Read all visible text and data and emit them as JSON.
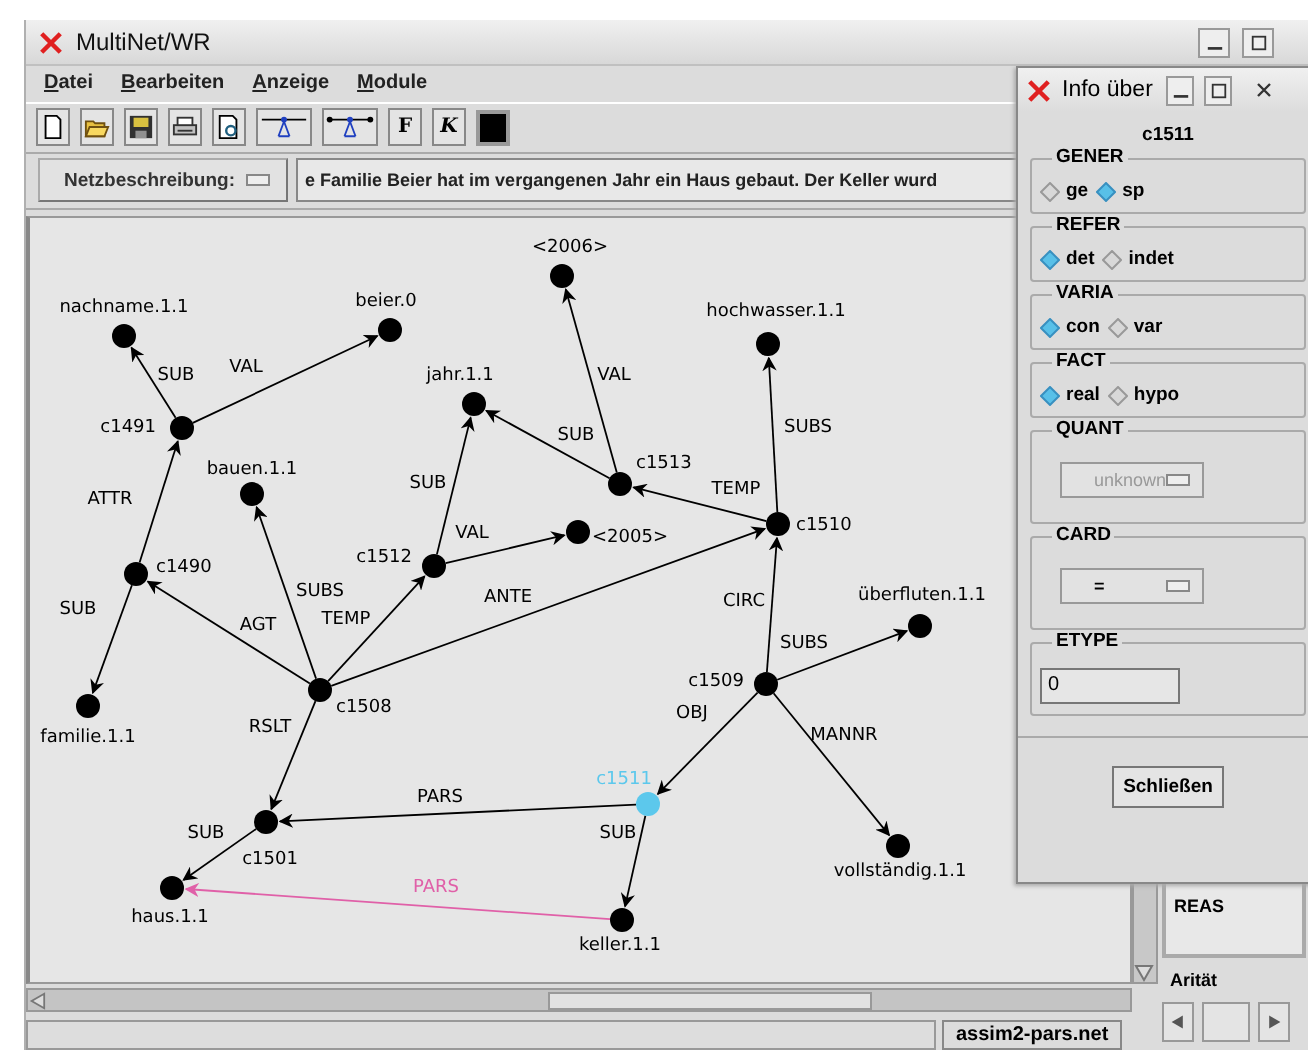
{
  "window": {
    "title": "MultiNet/WR"
  },
  "menu": [
    {
      "label": "Datei"
    },
    {
      "label": "Bearbeiten"
    },
    {
      "label": "Anzeige"
    },
    {
      "label": "Module"
    }
  ],
  "toolbar": [
    {
      "kind": "new"
    },
    {
      "kind": "open"
    },
    {
      "kind": "save"
    },
    {
      "kind": "print"
    },
    {
      "kind": "preview"
    },
    {
      "kind": "node-link"
    },
    {
      "kind": "node-link-wide"
    },
    {
      "kind": "bold",
      "label": "F"
    },
    {
      "kind": "italic",
      "label": "K"
    },
    {
      "kind": "swatch"
    }
  ],
  "description": {
    "label": "Netzbeschreibung:",
    "text": "e Familie Beier hat  im vergangenen Jahr ein Haus gebaut. Der Keller wurd"
  },
  "graph": {
    "nodes": [
      {
        "label": "nachname.1.1",
        "selected": false
      },
      {
        "label": "beier.0",
        "selected": false
      },
      {
        "label": "c1491",
        "selected": false
      },
      {
        "label": "bauen.1.1",
        "selected": false
      },
      {
        "label": "jahr.1.1",
        "selected": false
      },
      {
        "label": "<2006>",
        "selected": false
      },
      {
        "label": "hochwasser.1.1",
        "selected": false
      },
      {
        "label": "c1513",
        "selected": false
      },
      {
        "label": "c1510",
        "selected": false
      },
      {
        "label": "<2005>",
        "selected": false
      },
      {
        "label": "c1512",
        "selected": false
      },
      {
        "label": "c1490",
        "selected": false
      },
      {
        "label": "überfluten.1.1",
        "selected": false
      },
      {
        "label": "c1509",
        "selected": false
      },
      {
        "label": "familie.1.1",
        "selected": false
      },
      {
        "label": "c1508",
        "selected": false
      },
      {
        "label": "c1511",
        "selected": true
      },
      {
        "label": "c1501",
        "selected": false
      },
      {
        "label": "vollständig.1.1",
        "selected": false
      },
      {
        "label": "haus.1.1",
        "selected": false
      },
      {
        "label": "keller.1.1",
        "selected": false
      }
    ],
    "edges": [
      {
        "label": "SUB",
        "color": "#000000"
      },
      {
        "label": "VAL",
        "color": "#000000"
      },
      {
        "label": "ATTR",
        "color": "#000000"
      },
      {
        "label": "SUB",
        "color": "#000000"
      },
      {
        "label": "AGT",
        "color": "#000000"
      },
      {
        "label": "SUBS",
        "color": "#000000"
      },
      {
        "label": "TEMP",
        "color": "#000000"
      },
      {
        "label": "ANTE",
        "color": "#000000"
      },
      {
        "label": "SUB",
        "color": "#000000"
      },
      {
        "label": "VAL",
        "color": "#000000"
      },
      {
        "label": "SUB",
        "color": "#000000"
      },
      {
        "label": "VAL",
        "color": "#000000"
      },
      {
        "label": "TEMP",
        "color": "#000000"
      },
      {
        "label": "SUBS",
        "color": "#000000"
      },
      {
        "label": "CIRC",
        "color": "#000000"
      },
      {
        "label": "SUBS",
        "color": "#000000"
      },
      {
        "label": "OBJ",
        "color": "#000000"
      },
      {
        "label": "MANNR",
        "color": "#000000"
      },
      {
        "label": "RSLT",
        "color": "#000000"
      },
      {
        "label": "PARS",
        "color": "#000000"
      },
      {
        "label": "SUB",
        "color": "#000000"
      },
      {
        "label": "SUB",
        "color": "#000000"
      },
      {
        "label": "PARS",
        "color": "#e060a8"
      }
    ]
  },
  "status_bar": {
    "file": "assim2-pars.net"
  },
  "side_panel": {
    "list_item": "REAS",
    "label": "Arität"
  },
  "info_dialog": {
    "title": "Info über",
    "node": "c1511",
    "groups": [
      {
        "title": "GENER",
        "kind": "radio",
        "options": [
          {
            "label": "ge",
            "selected": false
          },
          {
            "label": "sp",
            "selected": true
          }
        ]
      },
      {
        "title": "REFER",
        "kind": "radio",
        "options": [
          {
            "label": "det",
            "selected": true
          },
          {
            "label": "indet",
            "selected": false
          }
        ]
      },
      {
        "title": "VARIA",
        "kind": "radio",
        "options": [
          {
            "label": "con",
            "selected": true
          },
          {
            "label": "var",
            "selected": false
          }
        ]
      },
      {
        "title": "FACT",
        "kind": "radio",
        "options": [
          {
            "label": "real",
            "selected": true
          },
          {
            "label": "hypo",
            "selected": false
          }
        ]
      },
      {
        "title": "QUANT",
        "kind": "dropdown",
        "value": "unknown",
        "disabled": true
      },
      {
        "title": "CARD",
        "kind": "dropdown",
        "value": "=",
        "disabled": false
      },
      {
        "title": "ETYPE",
        "kind": "field",
        "value": "0"
      }
    ],
    "button": "Schließen"
  }
}
